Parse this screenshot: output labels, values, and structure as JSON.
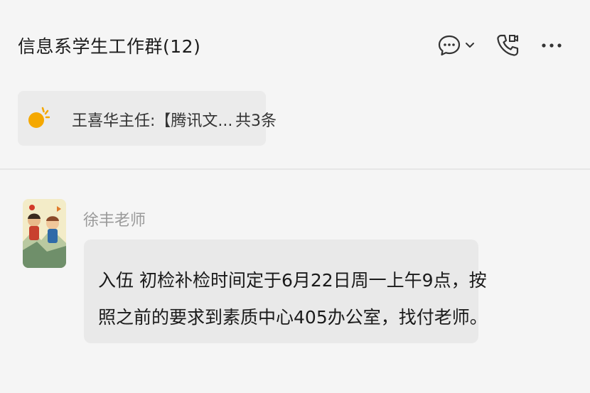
{
  "header": {
    "title": "信息系学生工作群(12)",
    "icons": [
      "chat-bubble-icon",
      "chevron-down-icon",
      "phone-call-icon",
      "more-icon"
    ]
  },
  "pinned": {
    "icon": "sun-icon",
    "text": "王喜华主任:【腾讯文...",
    "count": "共3条"
  },
  "message": {
    "sender": "徐丰老师",
    "avatar": "cartoon-avatar",
    "lines": [
      "入伍 初检补检时间定于6月22日周一上午9点，按",
      "照之前的要求到素质中心405办公室，找付老师。"
    ]
  },
  "colors": {
    "background": "#f5f5f5",
    "bubble": "#e9e9e9",
    "pinned_bg": "#ebebeb",
    "sun": "#f5a800",
    "sender_text": "#9a9a9a"
  }
}
